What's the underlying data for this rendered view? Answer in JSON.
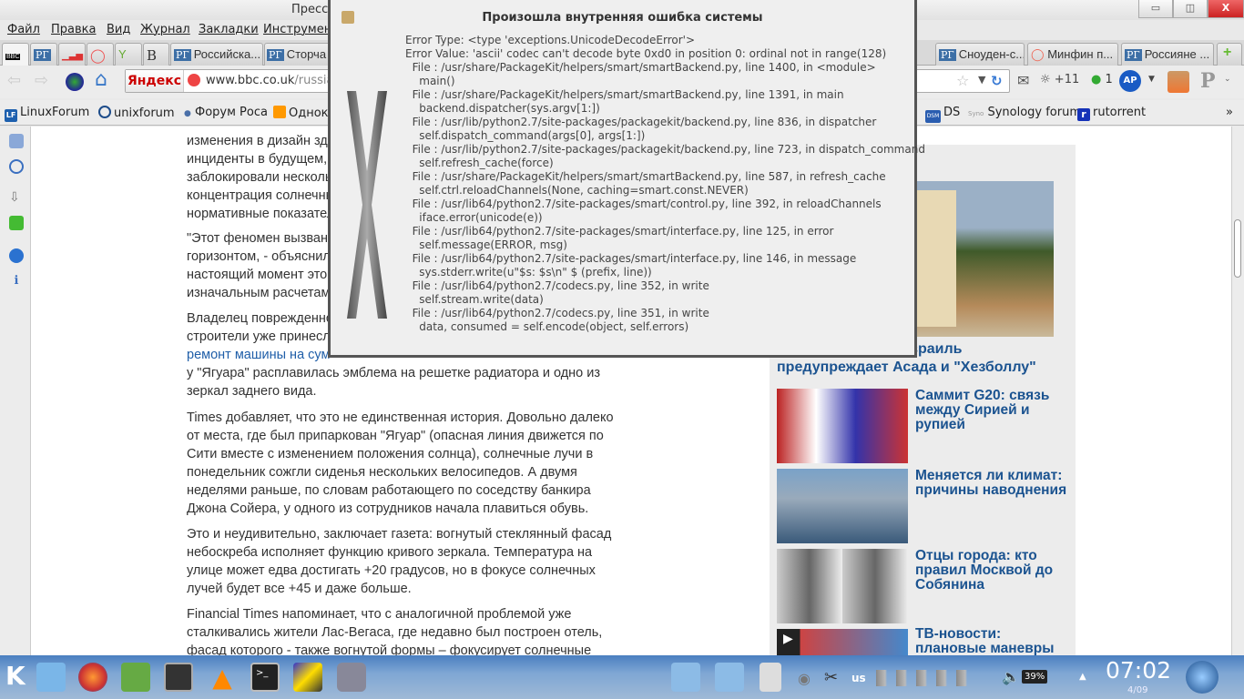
{
  "window": {
    "title": "Пресса",
    "minimize": "▭",
    "restore": "◫",
    "close": "X"
  },
  "menu": [
    "Файл",
    "Правка",
    "Вид",
    "Журнал",
    "Закладки",
    "Инструменты"
  ],
  "tabs": [
    {
      "label": "BBC"
    },
    {
      "label": ""
    },
    {
      "label": ""
    },
    {
      "label": ""
    },
    {
      "label": ""
    },
    {
      "label": "B"
    },
    {
      "label": "Российска..."
    },
    {
      "label": "Сторча"
    },
    {
      "label": "Сноуден-с..."
    },
    {
      "label": "Минфин п..."
    },
    {
      "label": "Россияне ..."
    }
  ],
  "tab_icon_rg": "РГ",
  "nav": {
    "search_engine": "Яндекс",
    "url_host": "www.bbc.co.uk",
    "url_path": "/russian",
    "weather": "+11",
    "counter": "1",
    "ap_label": "AP",
    "p_label": "P"
  },
  "bookmarks": [
    {
      "label": "LinuxForum",
      "icon": "LF"
    },
    {
      "label": "unixforum"
    },
    {
      "label": "Форум Роса"
    },
    {
      "label": "Однокл"
    },
    {
      "label": "DS",
      "icon": "DSM"
    },
    {
      "label": "Synology forum",
      "icon": "Syno"
    },
    {
      "label": "rutorrent",
      "icon": "r"
    }
  ],
  "bookmarks_more": "»",
  "article": {
    "lines": [
      "изменения в дизайн зда",
      "инциденты в будущем,",
      "заблокировали несколь",
      "концентрация солнечны",
      "нормативные показател",
      "\"Этот феномен вызван",
      "горизонтом, - объяснил",
      "настоящий момент это",
      "изначальным расчетам",
      "Владелец поврежденно",
      "строители уже принесл",
      "ремонт машины на сум",
      "у \"Ягуара\" расплавилась эмблема на решетке радиатора и одно из",
      "зеркал заднего вида.",
      "Times добавляет, что это не единственная история. Довольно далеко",
      "от места, где был припаркован \"Ягуар\" (опасная линия движется по",
      "Сити вместе с изменением положения солнца), солнечные лучи в",
      "понедельник сожгли сиденья нескольких велосипедов. А двумя",
      "неделями раньше, по словам работающего по соседству банкира",
      "Джона Сойера, у одного из сотрудников начала плавиться обувь.",
      "Это и неудивительно, заключает газета: вогнутый стеклянный фасад",
      "небоскреба исполняет функцию кривого зеркала. Температура на",
      "улице может едва достигать +20 градусов, но в фокусе солнечных",
      "лучей будет все +45 и даже больше.",
      "Financial Times напоминает, что с аналогичной проблемой уже",
      "сталкивались жители Лас-Вегаса, где недавно был построен отель,",
      "фасад которого - также вогнутой формы – фокусирует солнечные"
    ]
  },
  "sidebar": {
    "heading": "те",
    "lead_caption_1": "зраиль",
    "lead_caption_2": "предупреждает Асада и \"Хезболлу\"",
    "items": [
      {
        "title": "Саммит G20: связь между Сирией и рупией"
      },
      {
        "title": "Меняется ли климат: причины наводнения"
      },
      {
        "title": "Отцы города: кто правил Москвой до Собянина"
      },
      {
        "title": "ТВ-новости: плановые маневры"
      }
    ]
  },
  "dialog": {
    "title": "Произошла внутренняя ошибка системы",
    "trace": "Error Type: <type 'exceptions.UnicodeDecodeError'>\nError Value: 'ascii' codec can't decode byte 0xd0 in position 0: ordinal not in range(128)\n  File : /usr/share/PackageKit/helpers/smart/smartBackend.py, line 1400, in <module>\n    main()\n  File : /usr/share/PackageKit/helpers/smart/smartBackend.py, line 1391, in main\n    backend.dispatcher(sys.argv[1:])\n  File : /usr/lib/python2.7/site-packages/packagekit/backend.py, line 836, in dispatcher\n    self.dispatch_command(args[0], args[1:])\n  File : /usr/lib/python2.7/site-packages/packagekit/backend.py, line 723, in dispatch_command\n    self.refresh_cache(force)\n  File : /usr/share/PackageKit/helpers/smart/smartBackend.py, line 587, in refresh_cache\n    self.ctrl.reloadChannels(None, caching=smart.const.NEVER)\n  File : /usr/lib64/python2.7/site-packages/smart/control.py, line 392, in reloadChannels\n    iface.error(unicode(e))\n  File : /usr/lib64/python2.7/site-packages/smart/interface.py, line 125, in error\n    self.message(ERROR, msg)\n  File : /usr/lib64/python2.7/site-packages/smart/interface.py, line 146, in message\n    sys.stderr.write(u\"$s: $s\\n\" $ (prefix, line))\n  File : /usr/lib64/python2.7/codecs.py, line 352, in write\n    self.stream.write(data)\n  File : /usr/lib64/python2.7/codecs.py, line 351, in write\n    data, consumed = self.encode(object, self.errors)"
  },
  "taskbar": {
    "kde": "K",
    "keyboard_layout": "us",
    "battery": "39%",
    "clock": "07:02",
    "date": "4/09"
  }
}
